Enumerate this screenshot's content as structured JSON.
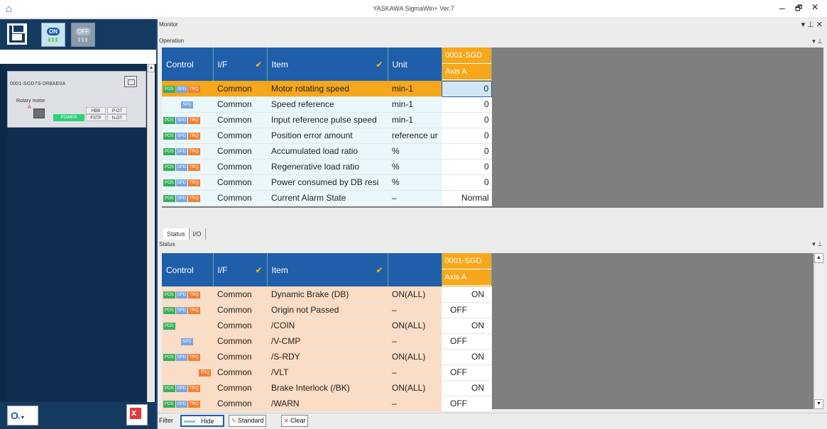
{
  "window": {
    "title": "YASKAWA SigmaWin+ Ver.7",
    "minimize": "–",
    "restore": "🗗",
    "close": "✕",
    "home_icon": "home-icon"
  },
  "left": {
    "on_label": "ON",
    "off_label": "OFF",
    "device": {
      "name": "0001-SGD7S-0R8AE0A",
      "motor": "Rotary motor",
      "power": "POWER",
      "cells": [
        "HBB",
        "P-OT",
        "FSTP",
        "N-OT"
      ],
      "alarm_mark": "A"
    }
  },
  "monitor": {
    "title": "Monitor",
    "ctrls": "▾ ⊥ ✕",
    "section": "Operation",
    "section_ctrls": "▾ ⊥"
  },
  "op_table": {
    "headers": {
      "control": "Control",
      "if": "I/F",
      "item": "Item",
      "unit": "Unit",
      "axis_top": "0001-SGD",
      "axis_bot": "Axis A"
    },
    "rows": [
      {
        "tags": [
          "POS",
          "SPD",
          "TRQ"
        ],
        "if": "Common",
        "item": "Motor rotating speed",
        "unit": "min-1",
        "val": "0"
      },
      {
        "tags": [
          "SPD"
        ],
        "if": "Common",
        "item": "Speed reference",
        "unit": "min-1",
        "val": "0"
      },
      {
        "tags": [
          "POS",
          "SPD",
          "TRQ"
        ],
        "if": "Common",
        "item": "Input reference pulse speed",
        "unit": "min-1",
        "val": "0"
      },
      {
        "tags": [
          "POS",
          "SPD",
          "TRQ"
        ],
        "if": "Common",
        "item": "Position error amount",
        "unit": "reference ur",
        "val": "0"
      },
      {
        "tags": [
          "POS",
          "SPD",
          "TRQ"
        ],
        "if": "Common",
        "item": "Accumulated load ratio",
        "unit": "%",
        "val": "0"
      },
      {
        "tags": [
          "POS",
          "SPD",
          "TRQ"
        ],
        "if": "Common",
        "item": "Regenerative load ratio",
        "unit": "%",
        "val": "0"
      },
      {
        "tags": [
          "POS",
          "SPD",
          "TRQ"
        ],
        "if": "Common",
        "item": "Power consumed by DB resi",
        "unit": "%",
        "val": "0"
      },
      {
        "tags": [
          "POS",
          "SPD",
          "TRQ"
        ],
        "if": "Common",
        "item": "Current Alarm State",
        "unit": "–",
        "val": "Normal"
      }
    ]
  },
  "tabs": [
    "Status",
    "I/O"
  ],
  "status": {
    "section": "Status",
    "section_ctrls": "▾ ⊥"
  },
  "st_table": {
    "headers": {
      "control": "Control",
      "if": "I/F",
      "item": "Item",
      "axis_top": "0001-SGD",
      "axis_bot": "Axis A"
    },
    "rows": [
      {
        "tags": [
          "POS",
          "SPD",
          "TRQ"
        ],
        "if": "Common",
        "item": "Dynamic Brake (DB)",
        "unit": "ON(ALL)",
        "val": "ON"
      },
      {
        "tags": [
          "POS",
          "SPD",
          "TRQ"
        ],
        "if": "Common",
        "item": "Origin not Passed",
        "unit": "–",
        "val": "OFF"
      },
      {
        "tags": [
          "POS"
        ],
        "if": "Common",
        "item": "/COIN",
        "unit": "ON(ALL)",
        "val": "ON"
      },
      {
        "tags": [
          "SPD"
        ],
        "if": "Common",
        "item": "/V-CMP",
        "unit": "–",
        "val": "OFF"
      },
      {
        "tags": [
          "POS",
          "SPD",
          "TRQ"
        ],
        "if": "Common",
        "item": "/S-RDY",
        "unit": "ON(ALL)",
        "val": "ON"
      },
      {
        "tags": [
          "TRQ"
        ],
        "if": "Common",
        "item": "/VLT",
        "unit": "–",
        "val": "OFF"
      },
      {
        "tags": [
          "POS",
          "SPD",
          "TRQ"
        ],
        "if": "Common",
        "item": "Brake Interlock (/BK)",
        "unit": "ON(ALL)",
        "val": "ON"
      },
      {
        "tags": [
          "POS",
          "SPD",
          "TRQ"
        ],
        "if": "Common",
        "item": "/WARN",
        "unit": "–",
        "val": "OFF"
      }
    ]
  },
  "filter": {
    "label": "Filter",
    "hide": "Hide",
    "standard": "Standard",
    "clear": "Clear"
  }
}
